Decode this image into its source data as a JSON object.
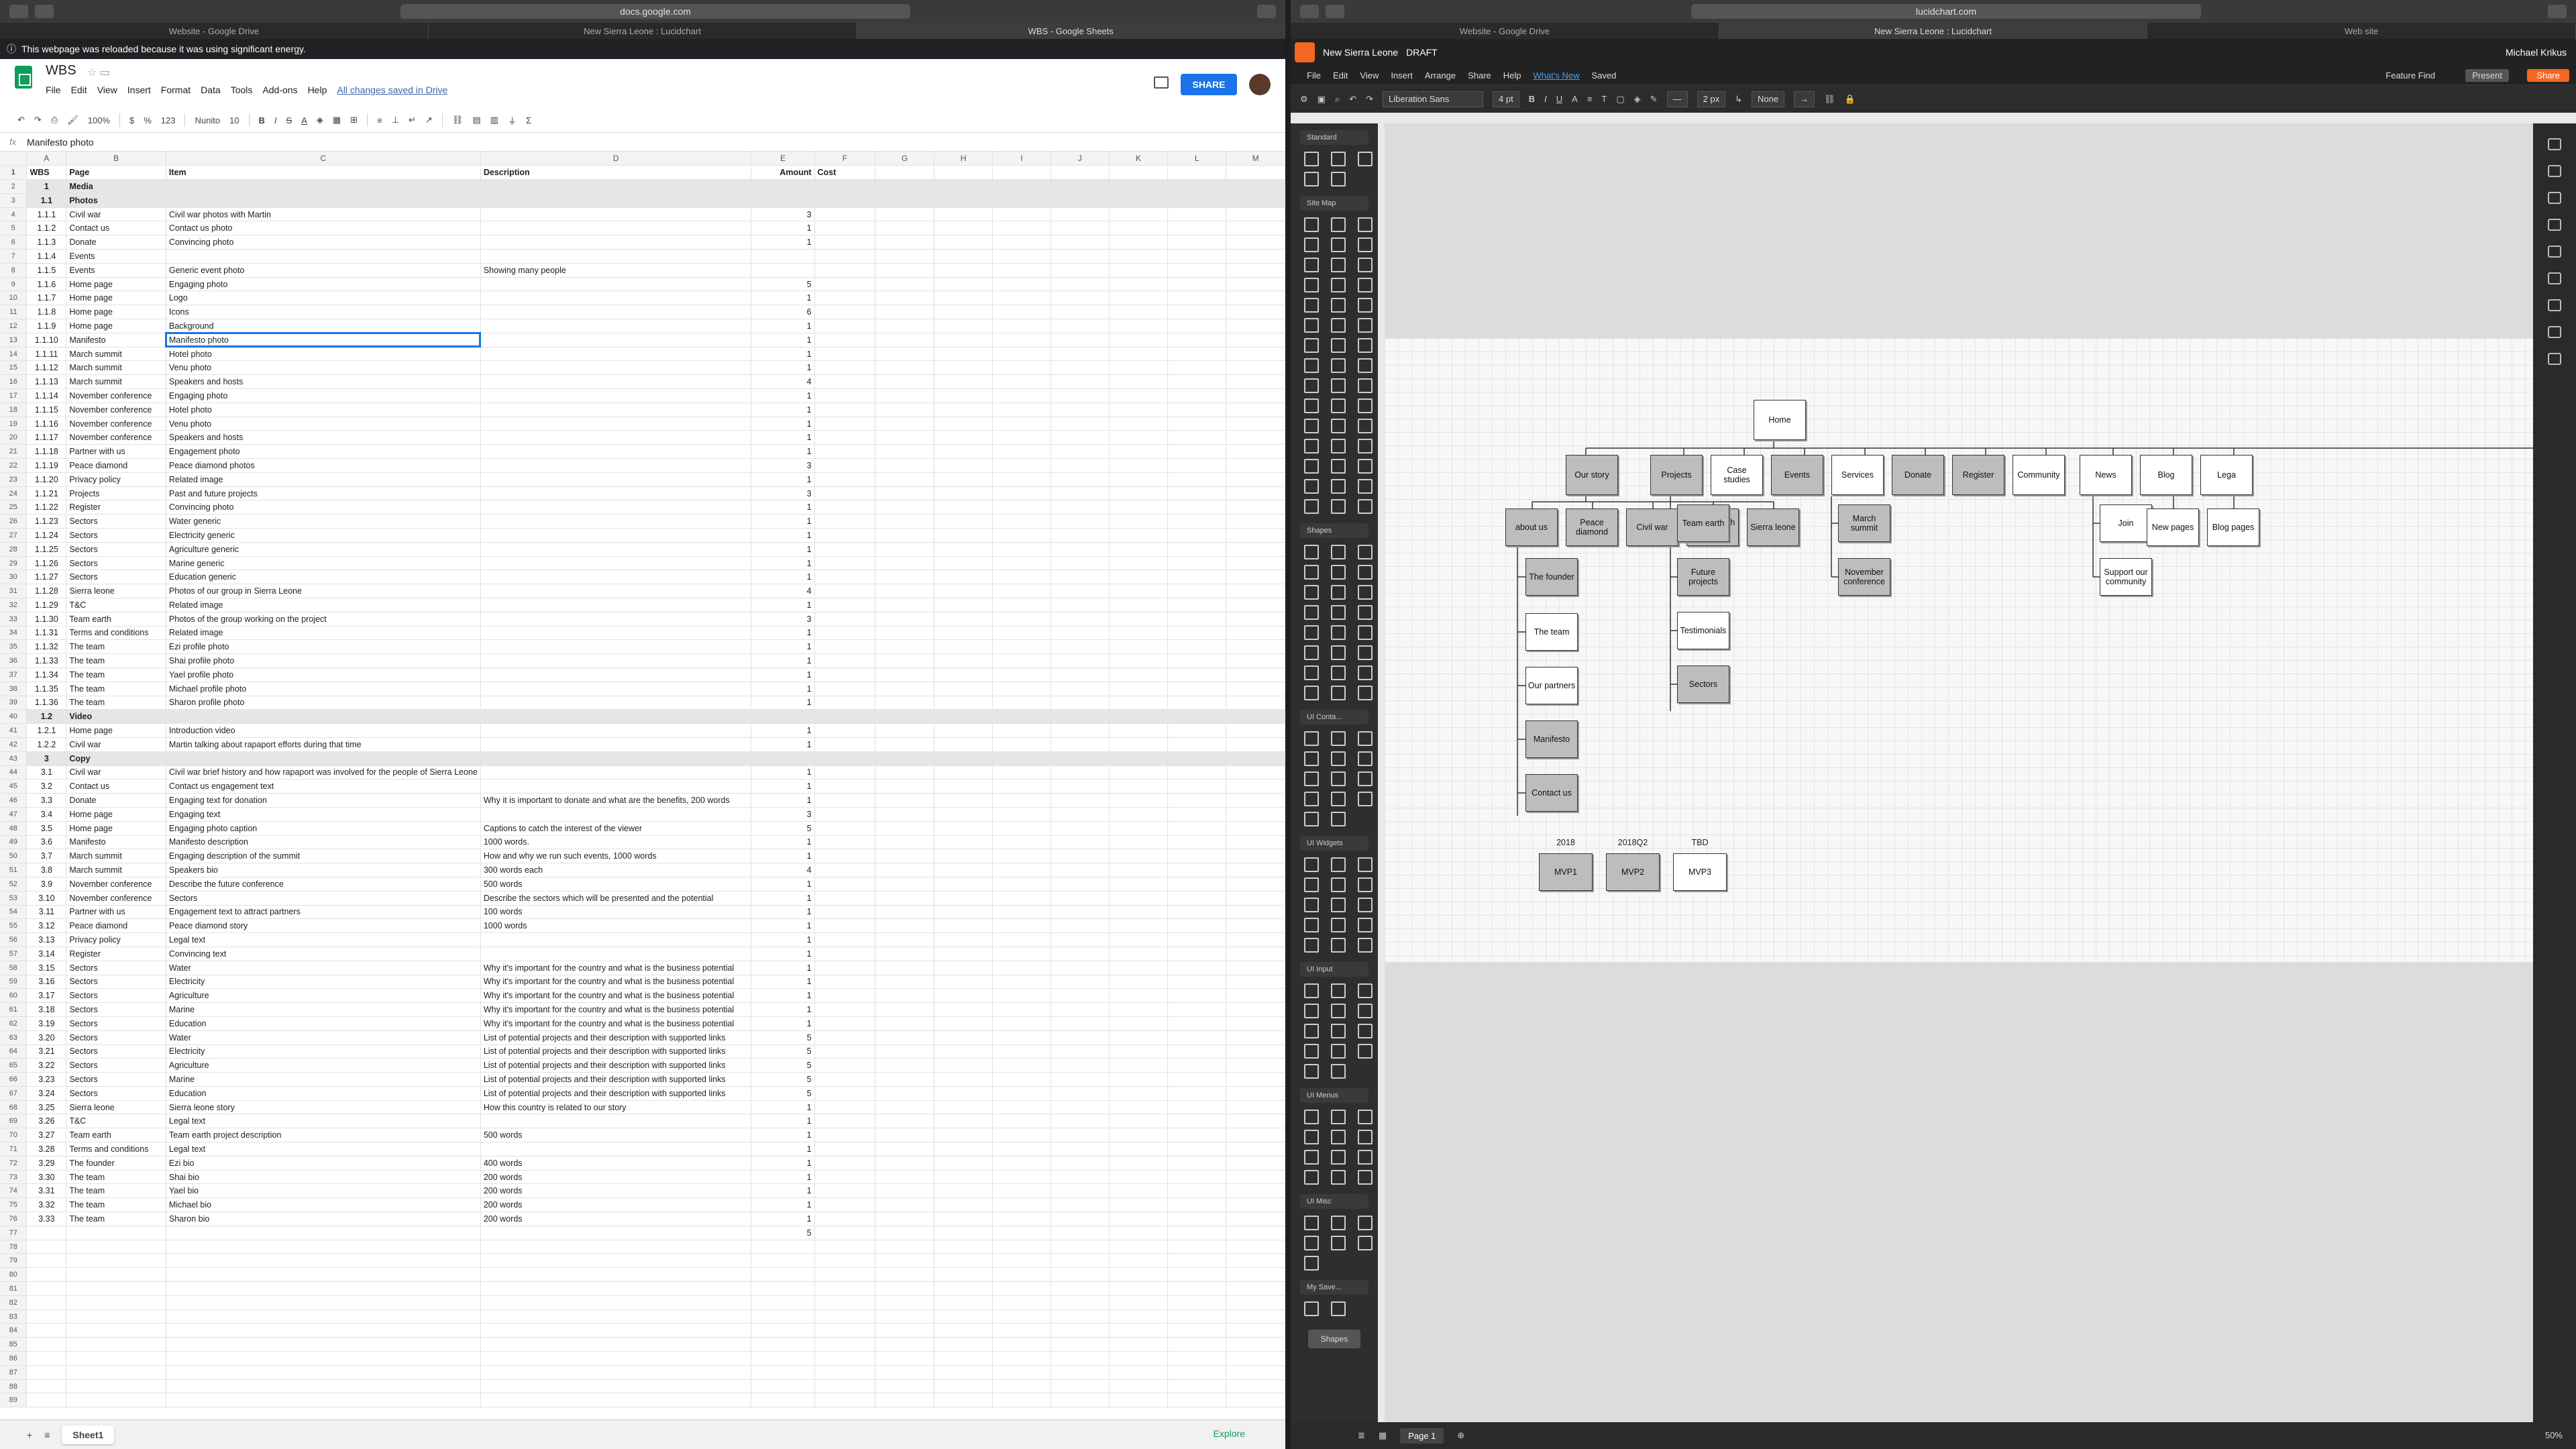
{
  "left": {
    "chrome": {
      "url": "docs.google.com",
      "tabs": [
        "Website - Google Drive",
        "New Sierra Leone : Lucidchart",
        "WBS - Google Sheets"
      ]
    },
    "notice": "This webpage was reloaded because it was using significant energy.",
    "doc_title": "WBS",
    "menu": [
      "File",
      "Edit",
      "View",
      "Insert",
      "Format",
      "Data",
      "Tools",
      "Add-ons",
      "Help"
    ],
    "saved": "All changes saved in Drive",
    "share": "SHARE",
    "toolbar": {
      "zoom": "100%",
      "currency": "$",
      "percent": "%",
      "format": "123",
      "font": "Nunito",
      "size": "10"
    },
    "formula": {
      "label": "fx",
      "value": "Manifesto photo"
    },
    "columns": [
      "A",
      "B",
      "C",
      "D",
      "E",
      "F",
      "G",
      "H",
      "I",
      "J",
      "K",
      "L",
      "M"
    ],
    "rows": [
      [
        "WBS",
        "Page",
        "Item",
        "Description",
        "Amount",
        "Cost"
      ],
      [
        "1",
        "Media",
        "",
        "",
        "",
        ""
      ],
      [
        "1.1",
        "Photos",
        "",
        "",
        "",
        ""
      ],
      [
        "1.1.1",
        "Civil war",
        "Civil war photos with Martin",
        "",
        "3",
        ""
      ],
      [
        "1.1.2",
        "Contact us",
        "Contact us photo",
        "",
        "1",
        ""
      ],
      [
        "1.1.3",
        "Donate",
        "Convincing photo",
        "",
        "1",
        ""
      ],
      [
        "1.1.4",
        "Events",
        "",
        "",
        "",
        ""
      ],
      [
        "1.1.5",
        "Events",
        "Generic event photo",
        "Showing many people",
        "",
        ""
      ],
      [
        "1.1.6",
        "Home page",
        "Engaging photo",
        "",
        "5",
        ""
      ],
      [
        "1.1.7",
        "Home page",
        "Logo",
        "",
        "1",
        ""
      ],
      [
        "1.1.8",
        "Home page",
        "Icons",
        "",
        "6",
        ""
      ],
      [
        "1.1.9",
        "Home page",
        "Background",
        "",
        "1",
        ""
      ],
      [
        "1.1.10",
        "Manifesto",
        "Manifesto photo",
        "",
        "1",
        ""
      ],
      [
        "1.1.11",
        "March summit",
        "Hotel photo",
        "",
        "1",
        ""
      ],
      [
        "1.1.12",
        "March summit",
        "Venu photo",
        "",
        "1",
        ""
      ],
      [
        "1.1.13",
        "March summit",
        "Speakers and hosts",
        "",
        "4",
        ""
      ],
      [
        "1.1.14",
        "November conference",
        "Engaging photo",
        "",
        "1",
        ""
      ],
      [
        "1.1.15",
        "November conference",
        "Hotel photo",
        "",
        "1",
        ""
      ],
      [
        "1.1.16",
        "November conference",
        "Venu photo",
        "",
        "1",
        ""
      ],
      [
        "1.1.17",
        "November conference",
        "Speakers and hosts",
        "",
        "1",
        ""
      ],
      [
        "1.1.18",
        "Partner with us",
        "Engagement photo",
        "",
        "1",
        ""
      ],
      [
        "1.1.19",
        "Peace diamond",
        "Peace diamond photos",
        "",
        "3",
        ""
      ],
      [
        "1.1.20",
        "Privacy policy",
        "Related image",
        "",
        "1",
        ""
      ],
      [
        "1.1.21",
        "Projects",
        "Past and future projects",
        "",
        "3",
        ""
      ],
      [
        "1.1.22",
        "Register",
        "Convincing photo",
        "",
        "1",
        ""
      ],
      [
        "1.1.23",
        "Sectors",
        "Water generic",
        "",
        "1",
        ""
      ],
      [
        "1.1.24",
        "Sectors",
        "Electricity generic",
        "",
        "1",
        ""
      ],
      [
        "1.1.25",
        "Sectors",
        "Agriculture generic",
        "",
        "1",
        ""
      ],
      [
        "1.1.26",
        "Sectors",
        "Marine generic",
        "",
        "1",
        ""
      ],
      [
        "1.1.27",
        "Sectors",
        "Education generic",
        "",
        "1",
        ""
      ],
      [
        "1.1.28",
        "Sierra leone",
        "Photos of our group in Sierra Leone",
        "",
        "4",
        ""
      ],
      [
        "1.1.29",
        "T&C",
        "Related image",
        "",
        "1",
        ""
      ],
      [
        "1.1.30",
        "Team earth",
        "Photos of the group working on the project",
        "",
        "3",
        ""
      ],
      [
        "1.1.31",
        "Terms and conditions",
        "Related image",
        "",
        "1",
        ""
      ],
      [
        "1.1.32",
        "The team",
        "Ezi profile photo",
        "",
        "1",
        ""
      ],
      [
        "1.1.33",
        "The team",
        "Shai profile photo",
        "",
        "1",
        ""
      ],
      [
        "1.1.34",
        "The team",
        "Yael profile photo",
        "",
        "1",
        ""
      ],
      [
        "1.1.35",
        "The team",
        "Michael profile photo",
        "",
        "1",
        ""
      ],
      [
        "1.1.36",
        "The team",
        "Sharon profile photo",
        "",
        "1",
        ""
      ],
      [
        "1.2",
        "Video",
        "",
        "",
        "",
        ""
      ],
      [
        "1.2.1",
        "Home page",
        "Introduction video",
        "",
        "1",
        ""
      ],
      [
        "1.2.2",
        "Civil war",
        "Martin talking about rapaport efforts during that time",
        "",
        "1",
        ""
      ],
      [
        "3",
        "Copy",
        "",
        "",
        "",
        ""
      ],
      [
        "3.1",
        "Civil war",
        "Civil war brief history and how rapaport was involved for the people of Sierra Leone",
        "",
        "1",
        ""
      ],
      [
        "3.2",
        "Contact us",
        "Contact us engagement text",
        "",
        "1",
        ""
      ],
      [
        "3.3",
        "Donate",
        "Engaging text for donation",
        "Why it is important to donate and what are the benefits, 200 words",
        "1",
        ""
      ],
      [
        "3.4",
        "Home page",
        "Engaging text",
        "",
        "3",
        ""
      ],
      [
        "3.5",
        "Home page",
        "Engaging photo caption",
        "Captions to catch the interest of the viewer",
        "5",
        ""
      ],
      [
        "3.6",
        "Manifesto",
        "Manifesto description",
        "1000 words.",
        "1",
        ""
      ],
      [
        "3.7",
        "March summit",
        "Engaging description of the summit",
        "How and why we run such events, 1000 words",
        "1",
        ""
      ],
      [
        "3.8",
        "March summit",
        "Speakers bio",
        "300 words each",
        "4",
        ""
      ],
      [
        "3.9",
        "November conference",
        "Describe the future conference",
        "500 words",
        "1",
        ""
      ],
      [
        "3.10",
        "November conference",
        "Sectors",
        "Describe the sectors which will be presented and the potential",
        "1",
        ""
      ],
      [
        "3.11",
        "Partner with us",
        "Engagement text to attract partners",
        "100 words",
        "1",
        ""
      ],
      [
        "3.12",
        "Peace diamond",
        "Peace diamond story",
        "1000 words",
        "1",
        ""
      ],
      [
        "3.13",
        "Privacy policy",
        "Legal text",
        "",
        "1",
        ""
      ],
      [
        "3.14",
        "Register",
        "Convincing text",
        "",
        "1",
        ""
      ],
      [
        "3.15",
        "Sectors",
        "Water",
        "Why it's important for the country and what is the business potential",
        "1",
        ""
      ],
      [
        "3.16",
        "Sectors",
        "Electricity",
        "Why it's important for the country and what is the business potential",
        "1",
        ""
      ],
      [
        "3.17",
        "Sectors",
        "Agriculture",
        "Why it's important for the country and what is the business potential",
        "1",
        ""
      ],
      [
        "3.18",
        "Sectors",
        "Marine",
        "Why it's important for the country and what is the business potential",
        "1",
        ""
      ],
      [
        "3.19",
        "Sectors",
        "Education",
        "Why it's important for the country and what is the business potential",
        "1",
        ""
      ],
      [
        "3.20",
        "Sectors",
        "Water",
        "List of potential projects and their description with supported links",
        "5",
        ""
      ],
      [
        "3.21",
        "Sectors",
        "Electricity",
        "List of potential projects and their description with supported links",
        "5",
        ""
      ],
      [
        "3.22",
        "Sectors",
        "Agriculture",
        "List of potential projects and their description with supported links",
        "5",
        ""
      ],
      [
        "3.23",
        "Sectors",
        "Marine",
        "List of potential projects and their description with supported links",
        "5",
        ""
      ],
      [
        "3.24",
        "Sectors",
        "Education",
        "List of potential projects and their description with supported links",
        "5",
        ""
      ],
      [
        "3.25",
        "Sierra leone",
        "Sierra leone story",
        "How this country is related to our story",
        "1",
        ""
      ],
      [
        "3.26",
        "T&C",
        "Legal text",
        "",
        "1",
        ""
      ],
      [
        "3.27",
        "Team earth",
        "Team earth project description",
        "500 words",
        "1",
        ""
      ],
      [
        "3.28",
        "Terms and conditions",
        "Legal text",
        "",
        "1",
        ""
      ],
      [
        "3.29",
        "The founder",
        "Ezi bio",
        "400 words",
        "1",
        ""
      ],
      [
        "3.30",
        "The team",
        "Shai bio",
        "200 words",
        "1",
        ""
      ],
      [
        "3.31",
        "The team",
        "Yael bio",
        "200 words",
        "1",
        ""
      ],
      [
        "3.32",
        "The team",
        "Michael bio",
        "200 words",
        "1",
        ""
      ],
      [
        "3.33",
        "The team",
        "Sharon bio",
        "200 words",
        "1",
        ""
      ],
      [
        "",
        "",
        "",
        "",
        "5",
        ""
      ]
    ],
    "sheet_tab": "Sheet1",
    "explore": "Explore"
  },
  "right": {
    "tabs": [
      "Website - Google Drive",
      "New Sierra Leone : Lucidchart",
      "Web site"
    ],
    "url": "lucidchart.com",
    "doc_name": "New Sierra Leone",
    "draft": "DRAFT",
    "user": "Michael Krikus",
    "menu": [
      "File",
      "Edit",
      "View",
      "Insert",
      "Arrange",
      "Share",
      "Help"
    ],
    "whats_new": "What's New",
    "saved": "Saved",
    "feature_find": "Feature Find",
    "present": "Present",
    "share": "Share",
    "font": "Liberation Sans",
    "font_size": "4 pt",
    "line_width": "2 px",
    "line_end": "None",
    "libraries": [
      "Standard",
      "Site Map",
      "Shapes",
      "UI Conta...",
      "UI Widgets",
      "UI Input",
      "UI Menus",
      "UI Misc",
      "My Save..."
    ],
    "add_shapes": "Shapes",
    "diagram": {
      "root": "Home",
      "level1": [
        "Our story",
        "Projects",
        "Case studies",
        "Events",
        "Services",
        "Donate",
        "Register",
        "Community",
        "News",
        "Blog",
        "Lega"
      ],
      "our_story": [
        "about us",
        "Peace diamond",
        "Civil war",
        "Partner with us",
        "Sierra leone"
      ],
      "about_children": [
        "The founder",
        "The team",
        "Our partners",
        "Manifesto",
        "Contact us"
      ],
      "projects": [
        "Team earth",
        "Future projects",
        "Testimonials",
        "Sectors"
      ],
      "events": [
        "March summit",
        "November conference"
      ],
      "community": [
        "Join",
        "Support our community"
      ],
      "news": [
        "New pages"
      ],
      "blog": [
        "Blog pages"
      ],
      "mvp_labels": [
        "2018",
        "2018Q2",
        "TBD"
      ],
      "mvp": [
        "MVP1",
        "MVP2",
        "MVP3"
      ]
    },
    "page_tab": "Page 1",
    "zoom": "50%"
  }
}
